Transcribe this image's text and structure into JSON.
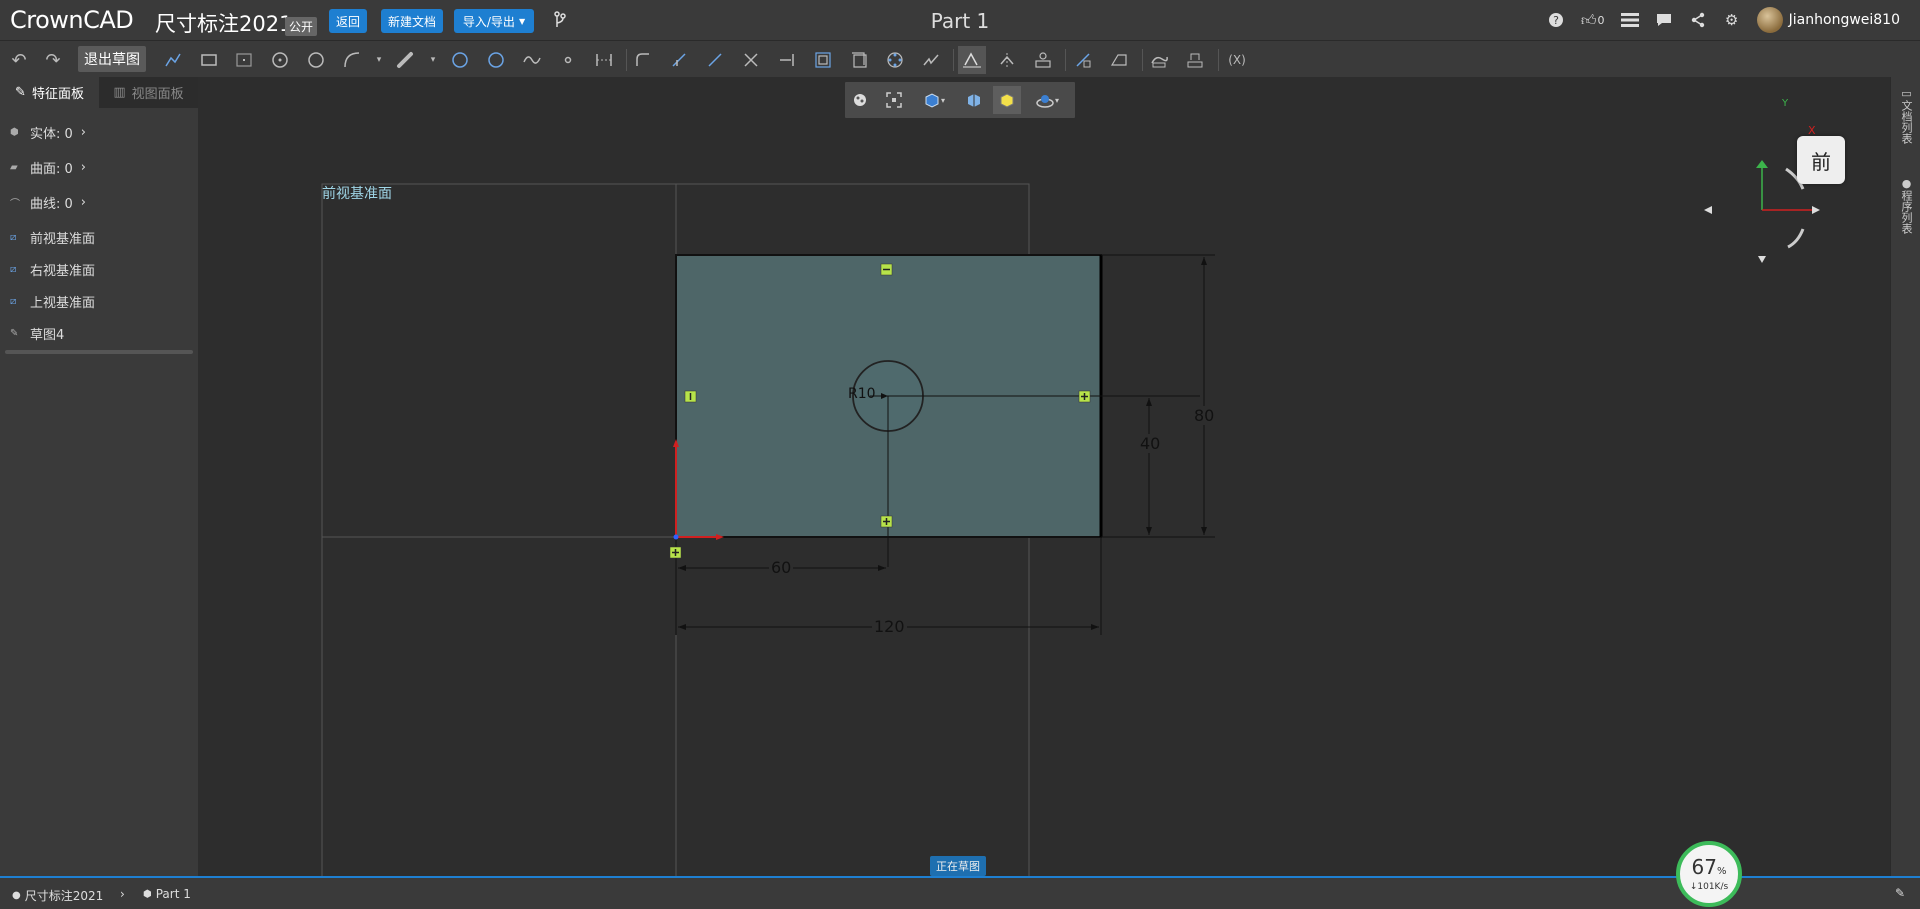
{
  "app": {
    "logo": "CrownCAD",
    "doc_title": "尺寸标注2021",
    "public_badge": "公开",
    "part_title": "Part 1",
    "username": "Jianhongwei810",
    "likes": "0"
  },
  "topbar": {
    "back_label": "返回",
    "new_doc_label": "新建文档",
    "import_export_label": "导入/导出"
  },
  "toolbar": {
    "exit_sketch_label": "退出草图",
    "variables_label": "(X)"
  },
  "panel": {
    "tab_feature": "特征面板",
    "tab_view": "视图面板",
    "solids": "实体: 0",
    "surfaces": "曲面: 0",
    "curves": "曲线: 0",
    "items": [
      {
        "label": "前视基准面",
        "icon": "plane-icon"
      },
      {
        "label": "右视基准面",
        "icon": "plane-icon"
      },
      {
        "label": "上视基准面",
        "icon": "plane-icon"
      },
      {
        "label": "草图4",
        "icon": "sketch-icon"
      }
    ]
  },
  "canvas": {
    "plane_label": "前视基准面",
    "dim_radius": "R10",
    "dim_80": "80",
    "dim_40": "40",
    "dim_60": "60",
    "dim_120": "120",
    "status": "正在草图",
    "viewcube_label": "前",
    "axis_x": "X",
    "axis_y": "Y"
  },
  "rightstrip": {
    "doc_list": "文档列表",
    "program_list": "程序列表"
  },
  "bottombar": {
    "crumb_doc": "尺寸标注2021",
    "crumb_part": "Part 1"
  },
  "perf": {
    "percent": "67",
    "percent_unit": "%",
    "speed": "↓101K/s"
  },
  "colors": {
    "accent": "#1e7fd1",
    "sketch_fill": "#4e6668",
    "constraint": "#b7e34a",
    "perf_ring": "#3dbb5a"
  }
}
